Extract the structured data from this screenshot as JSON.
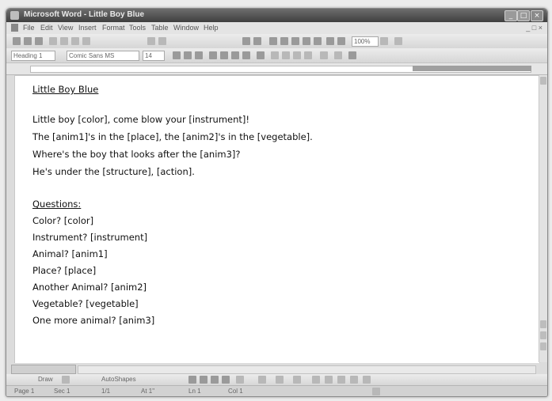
{
  "window": {
    "title": "Microsoft Word - Little Boy Blue",
    "minimize": "_",
    "maximize": "□",
    "close": "×"
  },
  "menu": {
    "items": [
      "File",
      "Edit",
      "View",
      "Insert",
      "Format",
      "Tools",
      "Table",
      "Window",
      "Help"
    ],
    "right": "_ □ ×"
  },
  "toolbar": {
    "style_box": "Heading 1",
    "font_box": "Comic Sans MS",
    "size_box": "14",
    "zoom_box": "100%"
  },
  "document": {
    "title": "Little Boy Blue",
    "poem": [
      "Little boy [color], come blow your [instrument]!",
      "The [anim1]'s in the [place], the [anim2]'s in the [vegetable].",
      "Where's the boy that looks after the [anim3]?",
      "He's under the [structure], [action]."
    ],
    "questions_heading": "Questions:",
    "questions": [
      "Color? [color]",
      "Instrument? [instrument]",
      "Animal? [anim1]",
      "Place? [place]",
      "Another Animal? [anim2]",
      "Vegetable? [vegetable]",
      "One more animal? [anim3]"
    ]
  },
  "drawing_toolbar": {
    "draw": "Draw",
    "autoshapes": "AutoShapes"
  },
  "status_bar": {
    "page": "Page 1",
    "sec": "Sec 1",
    "pos": "1/1",
    "at": "At 1\"",
    "ln": "Ln 1",
    "col": "Col 1"
  }
}
